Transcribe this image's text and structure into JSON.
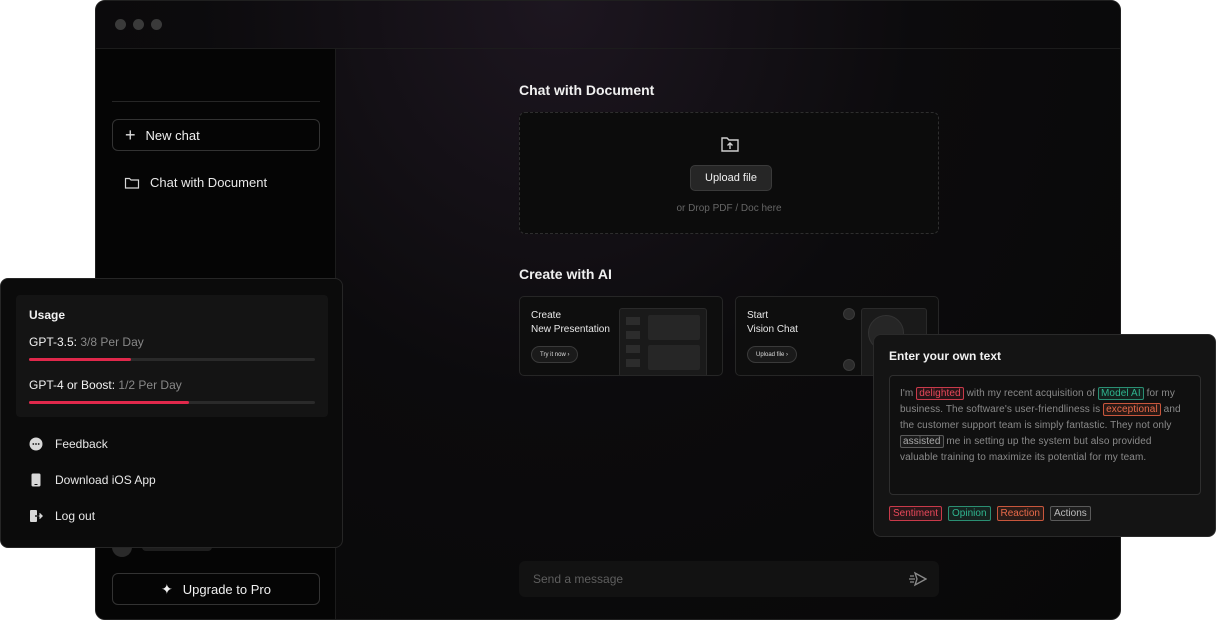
{
  "sidebar": {
    "new_chat": "New chat",
    "chat_with_document": "Chat with Document",
    "upgrade": "Upgrade to Pro"
  },
  "main": {
    "doc_section_title": "Chat with Document",
    "upload_button": "Upload file",
    "drop_hint": "or Drop PDF / Doc here",
    "create_section_title": "Create with AI",
    "cards": [
      {
        "line1": "Create",
        "line2": "New Presentation",
        "action": "Try it now ›"
      },
      {
        "line1": "Start",
        "line2": "Vision Chat",
        "action": "Upload file ›"
      }
    ],
    "message_placeholder": "Send a message"
  },
  "usage": {
    "title": "Usage",
    "rows": [
      {
        "label": "GPT-3.5:",
        "value": "3/8 Per Day",
        "fraction": 0.357
      },
      {
        "label": "GPT-4 or Boost:",
        "value": "1/2 Per Day",
        "fraction": 0.56
      }
    ],
    "menu": [
      {
        "label": "Feedback",
        "icon": "chat-bubble-icon"
      },
      {
        "label": "Download iOS App",
        "icon": "phone-icon"
      },
      {
        "label": "Log out",
        "icon": "logout-icon"
      }
    ]
  },
  "own_text": {
    "title": "Enter your own text",
    "text": {
      "s1": "I'm ",
      "w1": "delighted",
      "s2": " with my recent acquisition of ",
      "w2": "Model AI",
      "s3": " for my business. The software's user-friendliness is ",
      "w3": "exceptional",
      "s4": " and the customer support team is simply fantastic. They not only ",
      "w4": "assisted",
      "s5": " me in setting up the system but also provided valuable training to maximize its potential for my team."
    },
    "tags": [
      "Sentiment",
      "Opinion",
      "Reaction",
      "Actions"
    ]
  },
  "colors": {
    "accent": "#e0284b",
    "sentiment": "#e8485a",
    "opinion": "#2fb58f",
    "reaction": "#e86a4a",
    "actions": "#aaaaaa"
  }
}
